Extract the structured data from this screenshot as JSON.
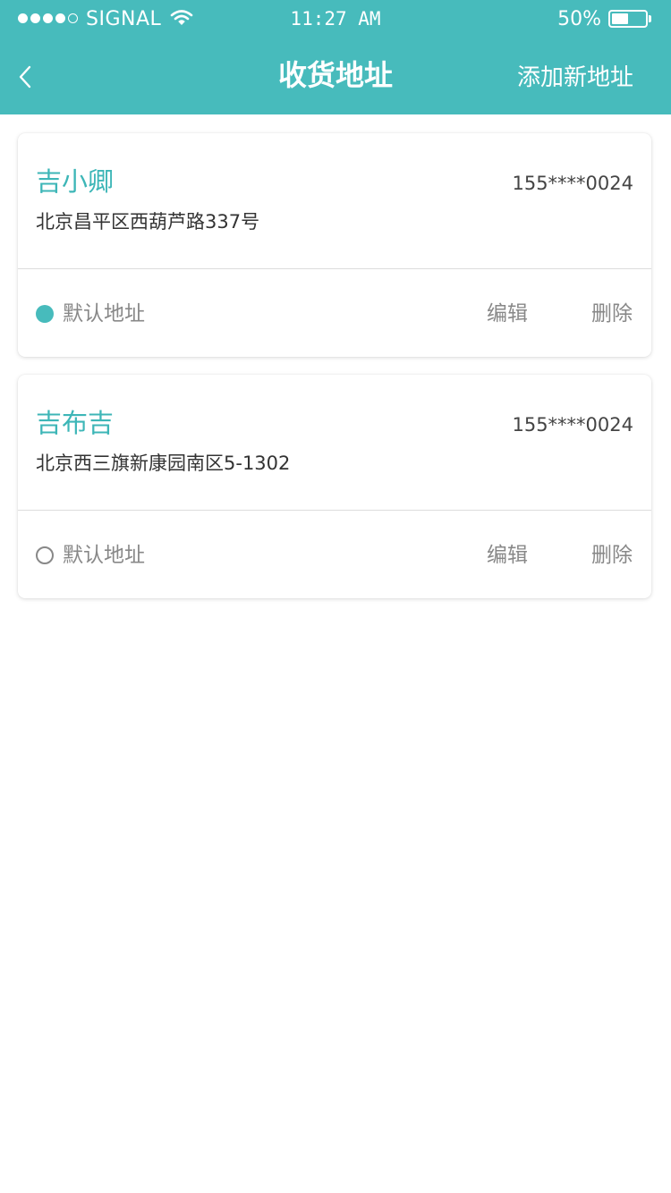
{
  "status_bar": {
    "carrier": "SIGNAL",
    "time": "11:27 AM",
    "battery_percent": "50%",
    "battery_level": 0.5,
    "signal_strength": "4 of 5"
  },
  "nav": {
    "back_icon": "chevron-left-icon",
    "title": "收货地址",
    "action_label": "添加新地址"
  },
  "colors": {
    "primary": "#47bbbc",
    "name_text": "#3db6b7",
    "muted_text": "#888888",
    "body_text": "#333333"
  },
  "addresses": [
    {
      "name": "吉小卿",
      "phone": "155****0024",
      "address": "北京昌平区西葫芦路337号",
      "is_default": true,
      "default_label": "默认地址",
      "edit_label": "编辑",
      "delete_label": "删除"
    },
    {
      "name": "吉布吉",
      "phone": "155****0024",
      "address": "北京西三旗新康园南区5-1302",
      "is_default": false,
      "default_label": "默认地址",
      "edit_label": "编辑",
      "delete_label": "删除"
    }
  ]
}
